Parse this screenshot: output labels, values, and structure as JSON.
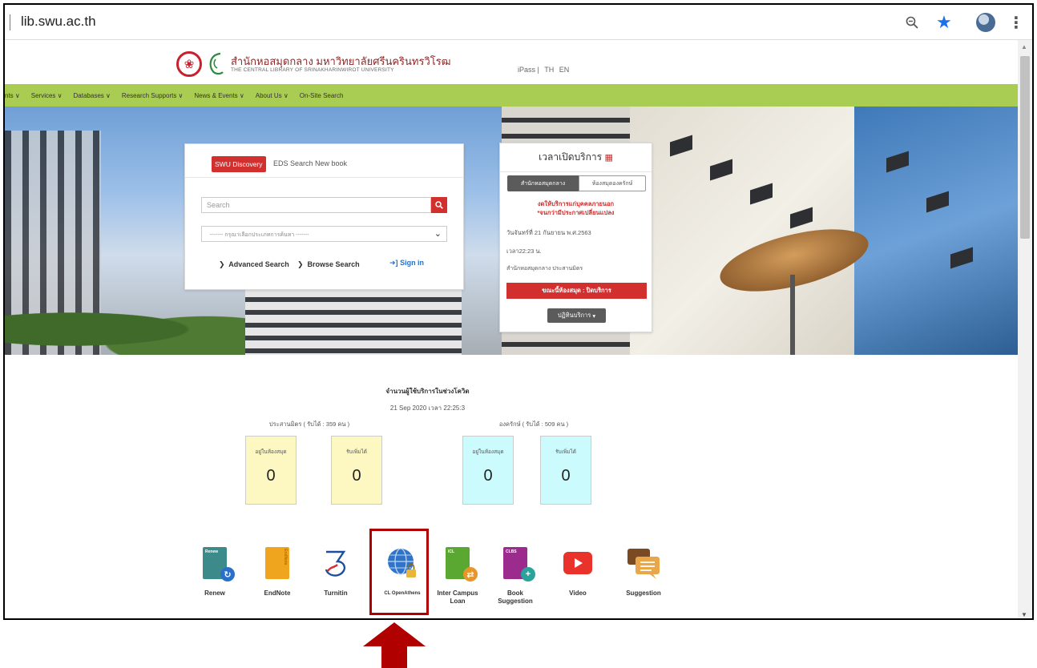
{
  "browser": {
    "url": "lib.swu.ac.th"
  },
  "header": {
    "logo_th": "สำนักหอสมุดกลาง มหาวิทยาลัยศรีนครินทรวิโรฒ",
    "logo_en": "THE CENTRAL LIBRARY OF SRINAKHARINWIROT UNIVERSITY",
    "top_links": [
      "iPass |",
      "TH",
      "EN"
    ]
  },
  "nav": {
    "items": [
      "nts ∨",
      "Services ∨",
      "Databases ∨",
      "Research Supports ∨",
      "News & Events ∨",
      "About Us ∨",
      "On-Site Search"
    ]
  },
  "search": {
    "tabs": [
      "SWU Discovery",
      "EDS Search",
      "New book"
    ],
    "placeholder": "Search",
    "type_placeholder": "------- กรุณาเลือกประเภทการค้นหา -------",
    "advanced": "Advanced Search",
    "browse": "Browse Search",
    "signin": "Sign in"
  },
  "hours": {
    "title": "เวลาเปิดบริการ",
    "tab_central": "สำนักหอสมุดกลาง",
    "tab_ongkharak": "ห้องสมุดองครักษ์",
    "notice_1": "งดให้บริการแก่บุคคลภายนอก",
    "notice_2": "*จนกว่ามีประกาศเปลี่ยนแปลง",
    "date": "วันจันทร์ที่ 21 กันยายน พ.ศ.2563",
    "time": "เวลา22:23 น.",
    "library": "สำนักหอสมุดกลาง ประสานมิตร",
    "status": "ขณะนี้ห้องสมุด : ปิดบริการ",
    "calendar_btn": "ปฏิทินบริการ"
  },
  "stats": {
    "title": "จำนวนผู้ใช้บริการในช่วงโควิด",
    "datetime": "21 Sep 2020  เวลา  22:25:3",
    "prasarn_label": "ประสานมิตร ( รับได้ : 359 คน )",
    "ongkharak_label": "องครักษ์ ( รับได้ : 509 คน )",
    "cards": [
      {
        "label": "อยู่ในห้องสมุด",
        "value": "0"
      },
      {
        "label": "รับเพิ่มได้",
        "value": "0"
      },
      {
        "label": "อยู่ในห้องสมุด",
        "value": "0"
      },
      {
        "label": "รับเพิ่มได้",
        "value": "0"
      }
    ]
  },
  "quick_links": {
    "renew": "Renew",
    "renew_tag": "Renew",
    "endnote": "EndNote",
    "endnote_tag": "EndNote",
    "turnitin": "Turnitin",
    "openathens": "CL OpenAthens",
    "icl_1": "Inter Campus",
    "icl_2": "Loan",
    "icl_tag": "ICL",
    "book_1": "Book",
    "book_2": "Suggestion",
    "book_tag": "CLBS",
    "video": "Video",
    "suggestion": "Suggestion"
  },
  "colors": {
    "nav_green": "#a9cc52",
    "brand_red": "#d22f2f",
    "highlight": "#b00000",
    "card_yellow": "#fdf8c2",
    "card_cyan": "#ccfbfd"
  }
}
